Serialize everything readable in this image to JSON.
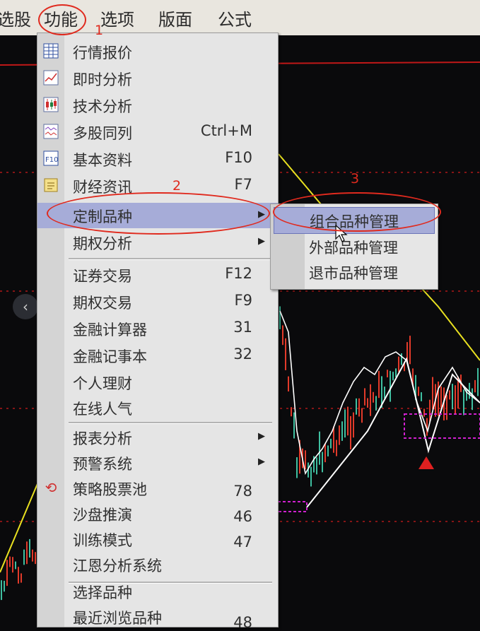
{
  "menubar": {
    "items": [
      "选股",
      "功能",
      "选项",
      "版面",
      "公式"
    ]
  },
  "menu": {
    "items": [
      {
        "label": "行情报价",
        "shortcut": "",
        "icon": "quote-table-icon"
      },
      {
        "label": "即时分析",
        "shortcut": "",
        "icon": "realtime-chart-icon"
      },
      {
        "label": "技术分析",
        "shortcut": "",
        "icon": "candlestick-icon"
      },
      {
        "label": "多股同列",
        "shortcut": "Ctrl+M",
        "icon": "multi-stock-icon"
      },
      {
        "label": "基本资料",
        "shortcut": "F10",
        "icon": "f10-icon"
      },
      {
        "label": "财经资讯",
        "shortcut": "F7",
        "icon": "news-icon"
      },
      {
        "label": "定制品种",
        "shortcut": "",
        "has_submenu": true,
        "highlighted": true
      },
      {
        "label": "期权分析",
        "shortcut": "",
        "has_submenu": true
      },
      {
        "label": "证券交易",
        "shortcut": "F12"
      },
      {
        "label": "期权交易",
        "shortcut": "F9"
      },
      {
        "label": "金融计算器",
        "shortcut": "31"
      },
      {
        "label": "金融记事本",
        "shortcut": "32"
      },
      {
        "label": "个人理财",
        "shortcut": ""
      },
      {
        "label": "在线人气",
        "shortcut": ""
      },
      {
        "label": "报表分析",
        "shortcut": "",
        "has_submenu": true
      },
      {
        "label": "预警系统",
        "shortcut": "",
        "has_submenu": true
      },
      {
        "label": "策略股票池",
        "shortcut": "78",
        "icon": "refresh-icon"
      },
      {
        "label": "沙盘推演",
        "shortcut": "46"
      },
      {
        "label": "训练模式",
        "shortcut": "47"
      },
      {
        "label": "江恩分析系统",
        "shortcut": ""
      },
      {
        "label": "选择品种",
        "shortcut": ""
      },
      {
        "label": "最近浏览品种",
        "shortcut": "48"
      }
    ]
  },
  "submenu": {
    "items": [
      {
        "label": "组合品种管理",
        "highlighted": true
      },
      {
        "label": "外部品种管理"
      },
      {
        "label": "退市品种管理"
      }
    ]
  },
  "annotations": {
    "n1": "1",
    "n2": "2",
    "n3": "3"
  },
  "colors": {
    "menu_bg": "#e5e5e5",
    "highlight": "#a6acd8",
    "annotation_red": "#e02a1e",
    "chart_bg": "#0a0a0c",
    "candle_up": "#e23a2a",
    "candle_down": "#3fbfa0",
    "trend_line": "#e8e020",
    "ma_line": "#ffffff",
    "box_line": "#d020d0"
  }
}
